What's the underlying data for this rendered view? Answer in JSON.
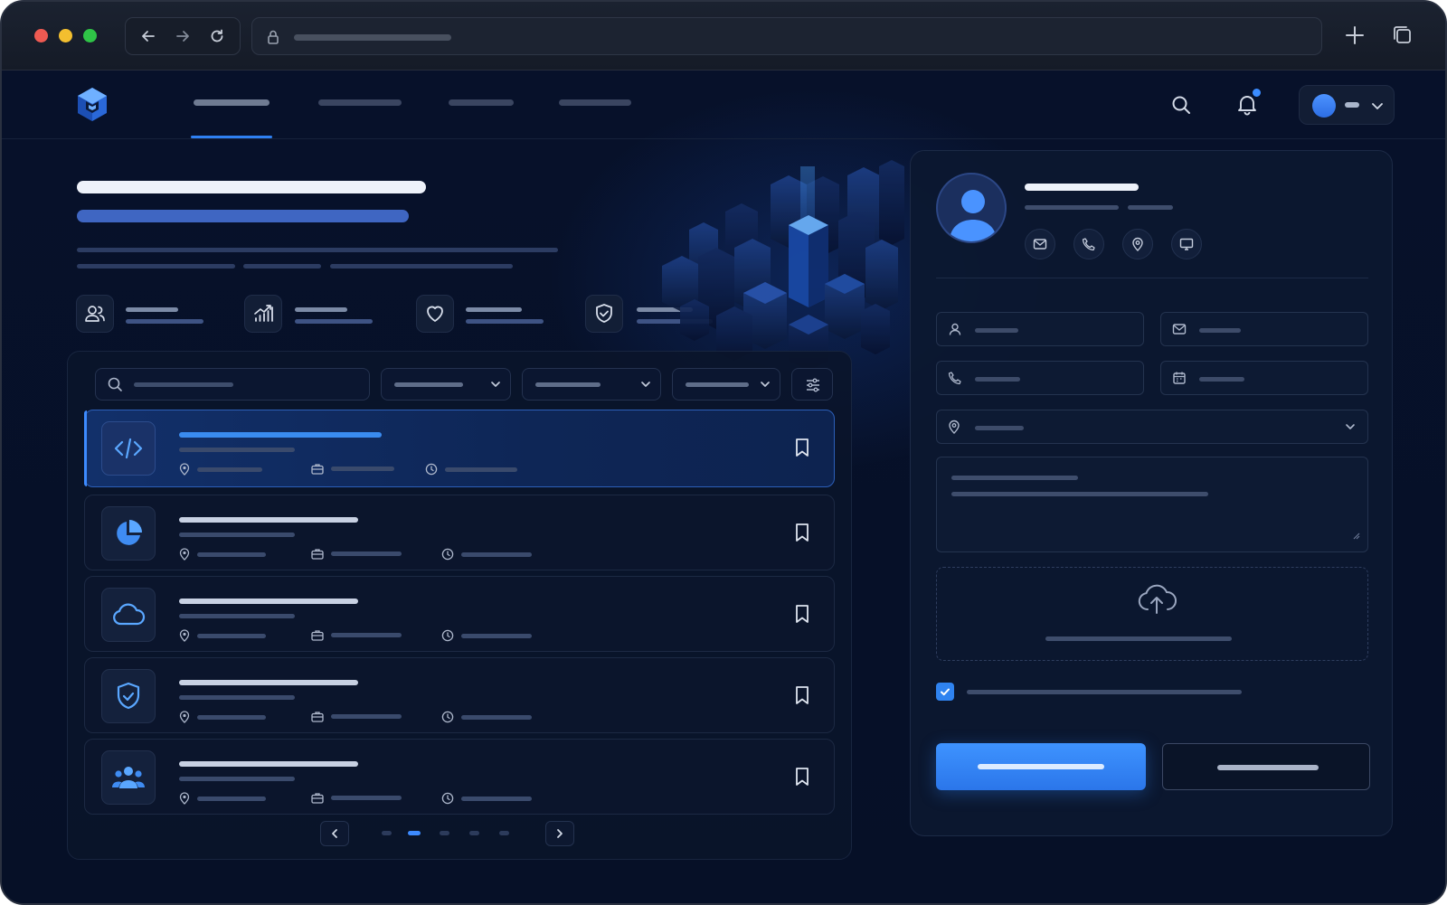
{
  "browser": {
    "window_controls": [
      "close",
      "minimize",
      "zoom"
    ],
    "nav_icons": [
      "back-icon",
      "forward-icon",
      "reload-icon"
    ],
    "url": "",
    "actions": [
      "new-tab-icon",
      "tabs-overview-icon"
    ]
  },
  "app": {
    "nav": {
      "logo_icon": "cube-logo-icon",
      "tabs_count": 4,
      "active_tab": 0
    },
    "header_icons": [
      "search-icon",
      "bell-icon",
      "chevron-down-icon"
    ],
    "notification_dot": true,
    "hero": {
      "features": [
        {
          "icon": "users-icon"
        },
        {
          "icon": "growth-chart-icon"
        },
        {
          "icon": "heart-icon"
        },
        {
          "icon": "shield-check-icon"
        }
      ]
    },
    "list": {
      "filters": [
        "search-input",
        "filter-dropdown-1",
        "filter-dropdown-2",
        "filter-dropdown-3",
        "sliders-icon"
      ],
      "rows": [
        {
          "icon": "code-icon",
          "selected": true
        },
        {
          "icon": "pie-chart-icon",
          "selected": false
        },
        {
          "icon": "cloud-icon",
          "selected": false
        },
        {
          "icon": "shield-icon",
          "selected": false
        },
        {
          "icon": "team-icon",
          "selected": false
        }
      ],
      "meta_icons": [
        "location-icon",
        "briefcase-icon",
        "clock-icon"
      ],
      "pagination": {
        "pages": 5,
        "current": 2
      }
    },
    "form": {
      "contact_icons": [
        "mail-icon",
        "phone-icon",
        "location-icon",
        "monitor-icon"
      ],
      "fields": [
        "person-icon",
        "mail-icon",
        "phone-icon",
        "calendar-icon",
        "location-icon"
      ],
      "upload_icon": "cloud-upload-icon",
      "agreement_checked": true
    },
    "colors": {
      "accent": "#2f80f2",
      "background": "#070f22",
      "panel": "#0c1830"
    }
  }
}
